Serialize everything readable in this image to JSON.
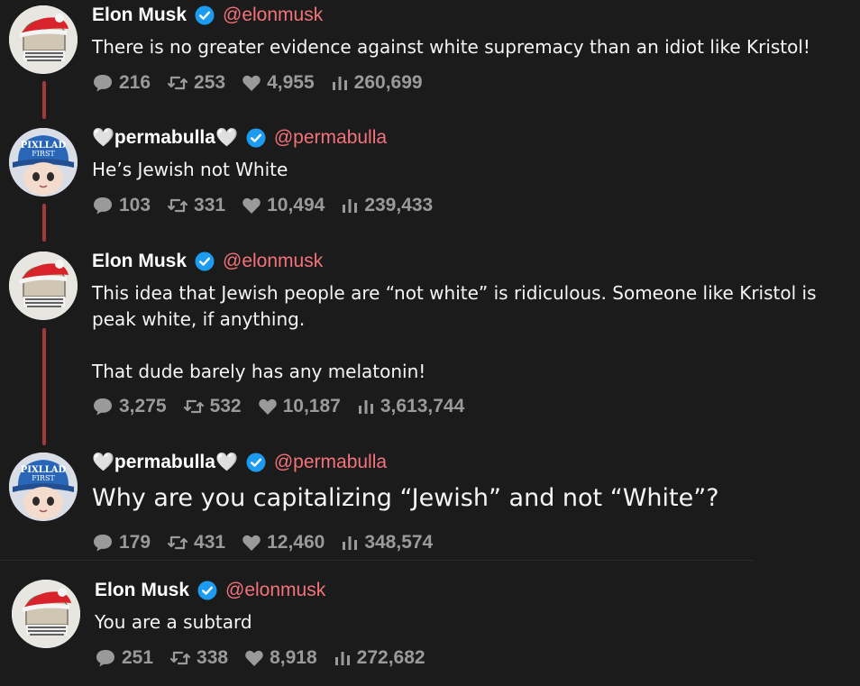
{
  "tweets": [
    {
      "avatar": "elon-avatar",
      "name": "Elon Musk",
      "prefix_heart": "",
      "suffix_heart": "",
      "verified": true,
      "handle": "@elonmusk",
      "text": "There is no greater evidence against white supremacy than an idiot like Kristol!",
      "stats": {
        "replies": "216",
        "retweets": "253",
        "likes": "4,955",
        "views": "260,699"
      }
    },
    {
      "avatar": "permabulla-avatar",
      "name": "permabulla",
      "prefix_heart": "🤍",
      "suffix_heart": "🤍",
      "verified": true,
      "handle": "@permabulla",
      "text": "He’s Jewish not White",
      "stats": {
        "replies": "103",
        "retweets": "331",
        "likes": "10,494",
        "views": "239,433"
      }
    },
    {
      "avatar": "elon-avatar",
      "name": "Elon Musk",
      "prefix_heart": "",
      "suffix_heart": "",
      "verified": true,
      "handle": "@elonmusk",
      "text": "This idea that Jewish people are “not white” is ridiculous. Someone like Kristol is\npeak white, if anything.\n\nThat dude barely has any melatonin!",
      "stats": {
        "replies": "3,275",
        "retweets": "532",
        "likes": "10,187",
        "views": "3,613,744"
      }
    },
    {
      "avatar": "permabulla-avatar",
      "name": "permabulla",
      "prefix_heart": "🤍",
      "suffix_heart": "🤍",
      "verified": true,
      "handle": "@permabulla",
      "text": "Why are you capitalizing “Jewish” and not “White”?",
      "stats": {
        "replies": "179",
        "retweets": "431",
        "likes": "12,460",
        "views": "348,574"
      }
    },
    {
      "avatar": "elon-avatar",
      "name": "Elon Musk",
      "prefix_heart": "",
      "suffix_heart": "",
      "verified": true,
      "handle": "@elonmusk",
      "text": "You are a subtard",
      "stats": {
        "replies": "251",
        "retweets": "338",
        "likes": "8,918",
        "views": "272,682"
      }
    }
  ],
  "colors": {
    "background": "#1b1b1c",
    "handle": "#f4727a",
    "verified": "#1d9bf0",
    "thread_line": "#a13a3a",
    "stats": "#9a9a9a"
  },
  "icons": {
    "reply": "reply-icon",
    "retweet": "retweet-icon",
    "like": "heart-icon",
    "views": "views-icon",
    "verified": "verified-badge-icon"
  }
}
